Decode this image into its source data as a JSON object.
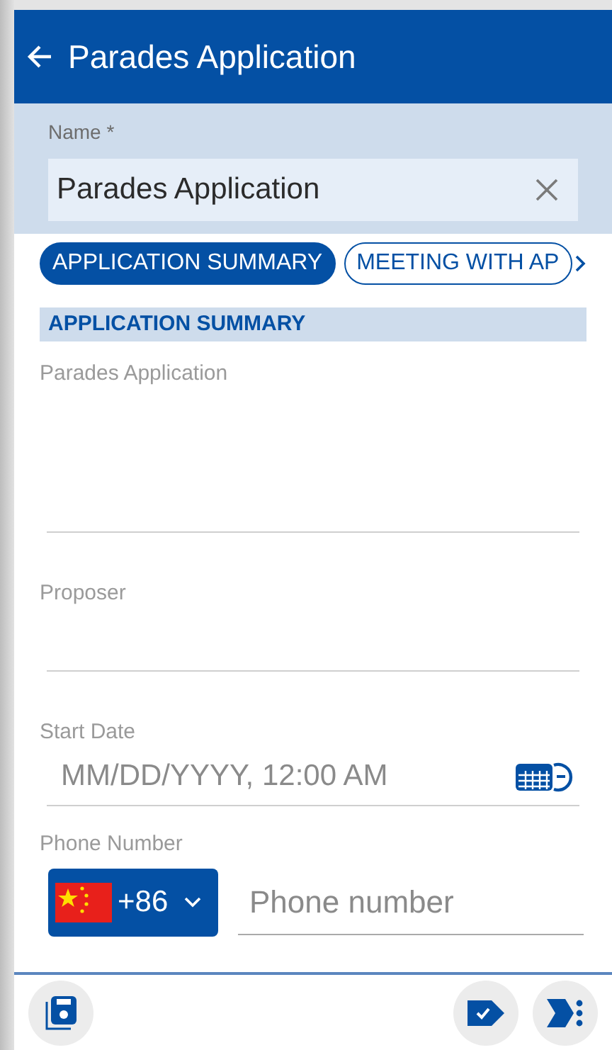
{
  "header": {
    "title": "Parades Application"
  },
  "name_field": {
    "label": "Name *",
    "value": "Parades Application"
  },
  "tabs": [
    {
      "label": "APPLICATION SUMMARY",
      "selected": true
    },
    {
      "label": "MEETING WITH AP",
      "selected": false
    }
  ],
  "section": {
    "title": "APPLICATION SUMMARY"
  },
  "fields": [
    {
      "kind": "textarea",
      "label": "Parades Application"
    },
    {
      "kind": "text",
      "label": "Proposer"
    },
    {
      "kind": "datetime",
      "label": "Start Date",
      "placeholder": "MM/DD/YYYY, 12:00 AM"
    },
    {
      "kind": "phone",
      "label": "Phone Number",
      "country_code": "+86",
      "placeholder": "Phone number"
    }
  ]
}
